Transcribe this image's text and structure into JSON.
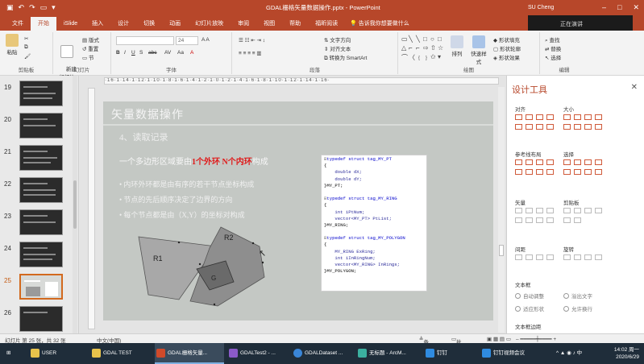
{
  "window": {
    "title": "GDAL栅格矢量数据操作.pptx - PowerPoint",
    "user": "SU Cheng",
    "overlay_text": "正在演讲"
  },
  "tabs": [
    "文件",
    "开始",
    "iSlide",
    "插入",
    "设计",
    "切换",
    "动画",
    "幻灯片放映",
    "审阅",
    "视图",
    "帮助",
    "福昕阅读",
    "告诉我你想要做什么"
  ],
  "ribbon": {
    "groups": [
      "剪贴板",
      "幻灯片",
      "字体",
      "段落",
      "绘图",
      "编辑"
    ],
    "paste": "粘贴",
    "new_slide": "新建\n幻灯片",
    "layout": "版式",
    "reset": "重置",
    "section": "节",
    "font_size": "24",
    "text_direction": "文字方向",
    "align_text": "对齐文本",
    "smartart": "转换为 SmartArt",
    "arrange": "排列",
    "quick_styles": "快速样式",
    "shape_fill": "形状填充",
    "shape_outline": "形状轮廓",
    "shape_effects": "形状效果",
    "find": "查找",
    "replace": "替换",
    "select": "选择"
  },
  "thumbnails": [
    {
      "num": "19"
    },
    {
      "num": "20"
    },
    {
      "num": "21"
    },
    {
      "num": "22"
    },
    {
      "num": "23"
    },
    {
      "num": "24"
    },
    {
      "num": "25",
      "selected": true
    },
    {
      "num": "26"
    }
  ],
  "slide": {
    "title": "矢量数据操作",
    "section": "4、读取记录",
    "intro_a": "一个多边形区域要由",
    "intro_red1": "1个外环",
    "intro_red2": "N个内环",
    "intro_b": "构成",
    "bullets": [
      "内环外环都是由有序的若干节点坐标构成",
      "节点的先后顺序决定了边界的方向",
      "每个节点都是由（X,Y）的坐标对构成"
    ],
    "labels": {
      "r1": "R1",
      "r2": "R2",
      "g": "G"
    },
    "code": [
      "typedef struct tag_MY_PT",
      "{",
      "    double dX;",
      "    double dY;",
      "}MY_PT;",
      "",
      "typedef struct tag_MY_RING",
      "{",
      "    int iPtNum;",
      "    vector<MY_PT> PtList;",
      "}MY_RING;",
      "",
      "typedef struct tag_MY_POLYGON",
      "{",
      "    MY_RING ExRing;",
      "    int iInRingNum;",
      "    vector<MY_RING> InRings;",
      "}MY_POLYGON;"
    ]
  },
  "design_pane": {
    "title": "设计工具",
    "sections": [
      "对齐",
      "大小",
      "参考线布局",
      "选择",
      "矢量",
      "剪贴板",
      "间距",
      "旋转",
      "文本框",
      "文本框边距"
    ],
    "radios": [
      "自动调整",
      "溢出文字",
      "适应形状",
      "允许换行"
    ]
  },
  "statusbar": {
    "slide_info": "幻灯片 第 25 张，共 32 张",
    "language": "中文(中国)",
    "notes": "备注",
    "comments": "批注"
  },
  "taskbar": {
    "items": [
      "USER",
      "GDAL TEST",
      "GDAL栅格矢量...",
      "GDALTest2 - ...",
      "GDALDataset ...",
      "无标题 - ArcM...",
      "钉钉",
      "钉钉视频会议"
    ],
    "time": "14:02 周一",
    "date": "2020/6/29"
  },
  "colors": {
    "accent": "#b7472a",
    "slide_bg": "#c4c8c4",
    "emphasis_red": "#e01818"
  }
}
